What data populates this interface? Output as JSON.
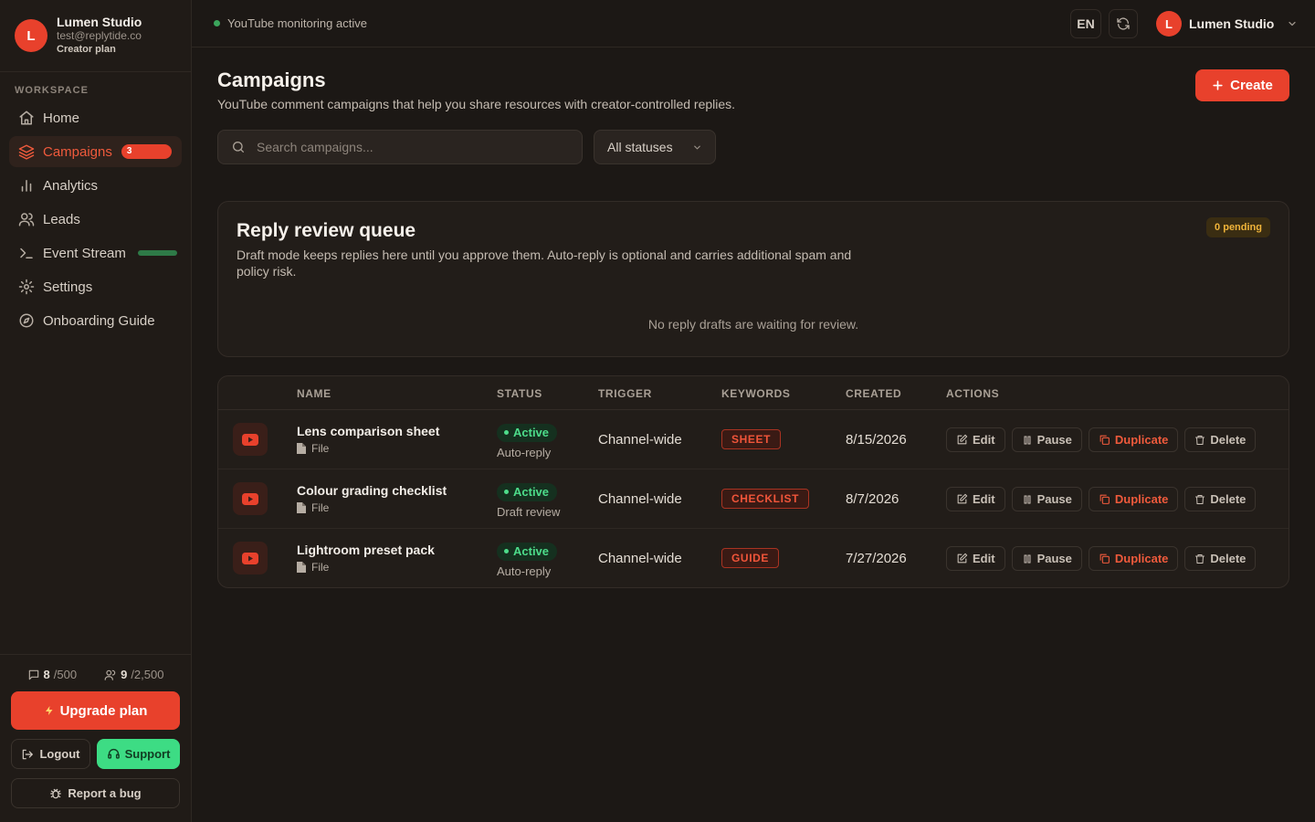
{
  "account": {
    "initial": "L",
    "name": "Lumen Studio",
    "email": "test@replytide.co",
    "plan": "Creator plan"
  },
  "sidebar": {
    "section_label": "WORKSPACE",
    "items": [
      {
        "label": "Home",
        "icon": "home-icon"
      },
      {
        "label": "Campaigns",
        "icon": "layers-icon",
        "badge": "3",
        "active": true
      },
      {
        "label": "Analytics",
        "icon": "bar-chart-icon"
      },
      {
        "label": "Leads",
        "icon": "users-icon"
      },
      {
        "label": "Event Stream",
        "icon": "terminal-icon",
        "live": true
      },
      {
        "label": "Settings",
        "icon": "gear-icon"
      },
      {
        "label": "Onboarding Guide",
        "icon": "compass-icon"
      }
    ],
    "usage": {
      "replies_used": "8",
      "replies_limit": "/500",
      "leads_used": "9",
      "leads_limit": "/2,500"
    },
    "upgrade_label": "Upgrade plan",
    "logout_label": "Logout",
    "support_label": "Support",
    "report_bug_label": "Report a bug"
  },
  "topbar": {
    "monitor_status": "YouTube monitoring active",
    "language": "EN",
    "user_name": "Lumen Studio"
  },
  "page": {
    "title": "Campaigns",
    "subtitle": "YouTube comment campaigns that help you share resources with creator-controlled replies.",
    "create_label": "Create",
    "search_placeholder": "Search campaigns...",
    "status_filter": "All statuses"
  },
  "queue": {
    "title": "Reply review queue",
    "description": "Draft mode keeps replies here until you approve them. Auto-reply is optional and carries additional spam and policy risk.",
    "pending": "0 pending",
    "empty": "No reply drafts are waiting for review."
  },
  "table": {
    "headers": {
      "name": "NAME",
      "status": "STATUS",
      "trigger": "TRIGGER",
      "keywords": "KEYWORDS",
      "created": "CREATED",
      "actions": "ACTIONS"
    },
    "action_labels": {
      "edit": "Edit",
      "pause": "Pause",
      "duplicate": "Duplicate",
      "delete": "Delete"
    },
    "rows": [
      {
        "name": "Lens comparison sheet",
        "type": "File",
        "status": "Active",
        "mode": "Auto-reply",
        "trigger": "Channel-wide",
        "keyword": "SHEET",
        "created": "8/15/2026"
      },
      {
        "name": "Colour grading checklist",
        "type": "File",
        "status": "Active",
        "mode": "Draft review",
        "trigger": "Channel-wide",
        "keyword": "CHECKLIST",
        "created": "8/7/2026"
      },
      {
        "name": "Lightroom preset pack",
        "type": "File",
        "status": "Active",
        "mode": "Auto-reply",
        "trigger": "Channel-wide",
        "keyword": "GUIDE",
        "created": "7/27/2026"
      }
    ]
  },
  "colors": {
    "accent": "#e8412c",
    "success": "#3ddc84",
    "background": "#1c1815",
    "sidebar": "#201b17",
    "warning": "#f0b43a"
  }
}
